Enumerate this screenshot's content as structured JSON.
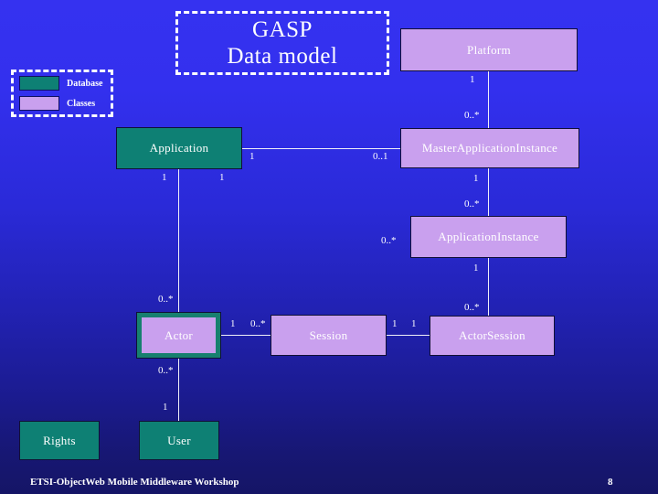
{
  "slide": {
    "title_line1": "GASP",
    "title_line2": "Data model",
    "background_top_color": "#3532f0",
    "background_bottom_color": "#151566"
  },
  "legend": {
    "items": [
      {
        "label": "Database",
        "color": "#0e8074"
      },
      {
        "label": "Classes",
        "color": "#c9a0ee"
      }
    ]
  },
  "diagram": {
    "type": "uml-class-diagram",
    "nodes": [
      {
        "id": "platform",
        "label": "Platform",
        "kind": "classes",
        "color": "#c9a0ee"
      },
      {
        "id": "application",
        "label": "Application",
        "kind": "database",
        "color": "#0e8074"
      },
      {
        "id": "masterappinst",
        "label": "MasterApplicationInstance",
        "kind": "classes",
        "color": "#c9a0ee"
      },
      {
        "id": "appinst",
        "label": "ApplicationInstance",
        "kind": "classes",
        "color": "#c9a0ee"
      },
      {
        "id": "actor",
        "label": "Actor",
        "kind": "both",
        "color": "#c9a0ee"
      },
      {
        "id": "session",
        "label": "Session",
        "kind": "classes",
        "color": "#c9a0ee"
      },
      {
        "id": "actorsession",
        "label": "ActorSession",
        "kind": "classes",
        "color": "#c9a0ee"
      },
      {
        "id": "rights",
        "label": "Rights",
        "kind": "database",
        "color": "#0e8074"
      },
      {
        "id": "user",
        "label": "User",
        "kind": "database",
        "color": "#0e8074"
      }
    ],
    "multiplicities": [
      {
        "id": "m1",
        "text": "1",
        "near": "platform-bottom"
      },
      {
        "id": "m2",
        "text": "0..*",
        "near": "masterappinst-top"
      },
      {
        "id": "m3",
        "text": "1",
        "near": "application-right"
      },
      {
        "id": "m4",
        "text": "0..1",
        "near": "masterappinst-left"
      },
      {
        "id": "m5",
        "text": "1",
        "near": "application-bottom-left"
      },
      {
        "id": "m6",
        "text": "1",
        "near": "application-bottom-right"
      },
      {
        "id": "m7",
        "text": "1",
        "near": "masterappinst-bottom"
      },
      {
        "id": "m8",
        "text": "0..*",
        "near": "appinst-top"
      },
      {
        "id": "m9",
        "text": "0..*",
        "near": "appinst-left"
      },
      {
        "id": "m10",
        "text": "1",
        "near": "appinst-bottom"
      },
      {
        "id": "m11",
        "text": "0..*",
        "near": "actorsession-top"
      },
      {
        "id": "m12",
        "text": "0..*",
        "near": "actor-top"
      },
      {
        "id": "m13",
        "text": "1",
        "near": "actor-right"
      },
      {
        "id": "m14",
        "text": "0..*",
        "near": "session-left"
      },
      {
        "id": "m15",
        "text": "1",
        "near": "session-right"
      },
      {
        "id": "m16",
        "text": "1",
        "near": "actorsession-left"
      },
      {
        "id": "m17",
        "text": "0..*",
        "near": "actor-bottom"
      },
      {
        "id": "m18",
        "text": "1",
        "near": "user-top"
      }
    ]
  },
  "footer": {
    "text": "ETSI-ObjectWeb Mobile Middleware Workshop",
    "page": "8"
  }
}
